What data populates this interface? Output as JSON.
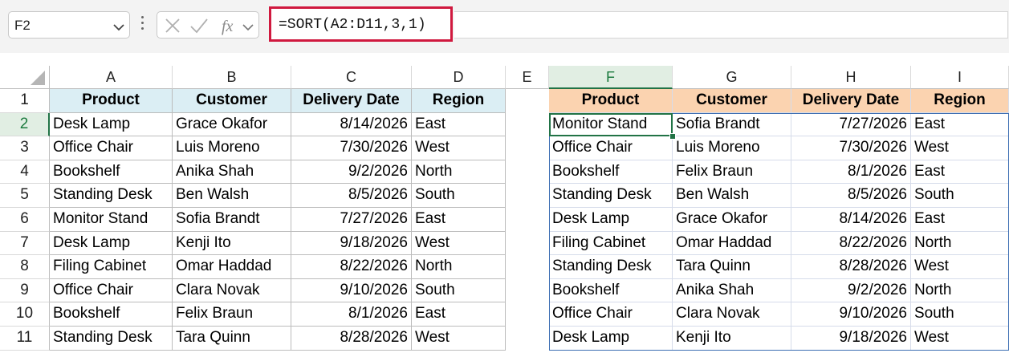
{
  "name_box": {
    "value": "F2"
  },
  "formula_bar": {
    "formula": "=SORT(A2:D11,3,1)"
  },
  "columns": [
    "A",
    "B",
    "C",
    "D",
    "E",
    "F",
    "G",
    "H",
    "I"
  ],
  "selected_column": "F",
  "selected_row": "2",
  "rows": [
    "1",
    "2",
    "3",
    "4",
    "5",
    "6",
    "7",
    "8",
    "9",
    "10",
    "11"
  ],
  "source_table": {
    "headers": [
      "Product",
      "Customer",
      "Delivery Date",
      "Region"
    ],
    "rows": [
      [
        "Desk Lamp",
        "Grace Okafor",
        "8/14/2026",
        "East"
      ],
      [
        "Office Chair",
        "Luis Moreno",
        "7/30/2026",
        "West"
      ],
      [
        "Bookshelf",
        "Anika Shah",
        "9/2/2026",
        "North"
      ],
      [
        "Standing Desk",
        "Ben Walsh",
        "8/5/2026",
        "South"
      ],
      [
        "Monitor Stand",
        "Sofia Brandt",
        "7/27/2026",
        "East"
      ],
      [
        "Desk Lamp",
        "Kenji Ito",
        "9/18/2026",
        "West"
      ],
      [
        "Filing Cabinet",
        "Omar Haddad",
        "8/22/2026",
        "North"
      ],
      [
        "Office Chair",
        "Clara Novak",
        "9/10/2026",
        "South"
      ],
      [
        "Bookshelf",
        "Felix Braun",
        "8/1/2026",
        "East"
      ],
      [
        "Standing Desk",
        "Tara Quinn",
        "8/28/2026",
        "West"
      ]
    ]
  },
  "sorted_table": {
    "headers": [
      "Product",
      "Customer",
      "Delivery Date",
      "Region"
    ],
    "rows": [
      [
        "Monitor Stand",
        "Sofia Brandt",
        "7/27/2026",
        "East"
      ],
      [
        "Office Chair",
        "Luis Moreno",
        "7/30/2026",
        "West"
      ],
      [
        "Bookshelf",
        "Felix Braun",
        "8/1/2026",
        "East"
      ],
      [
        "Standing Desk",
        "Ben Walsh",
        "8/5/2026",
        "South"
      ],
      [
        "Desk Lamp",
        "Grace Okafor",
        "8/14/2026",
        "East"
      ],
      [
        "Filing Cabinet",
        "Omar Haddad",
        "8/22/2026",
        "North"
      ],
      [
        "Standing Desk",
        "Tara Quinn",
        "8/28/2026",
        "West"
      ],
      [
        "Bookshelf",
        "Anika Shah",
        "9/2/2026",
        "North"
      ],
      [
        "Office Chair",
        "Clara Novak",
        "9/10/2026",
        "South"
      ],
      [
        "Desk Lamp",
        "Kenji Ito",
        "9/18/2026",
        "West"
      ]
    ]
  },
  "colors": {
    "source_header_fill": "#dbeef4",
    "sorted_header_fill": "#fbd3b0",
    "formula_highlight": "#d0193f",
    "selection_green": "#217346",
    "spill_border": "#3d6eb3"
  },
  "icons": [
    "chevron-down-icon",
    "more-options-icon",
    "cancel-icon",
    "enter-icon",
    "insert-function-icon"
  ]
}
